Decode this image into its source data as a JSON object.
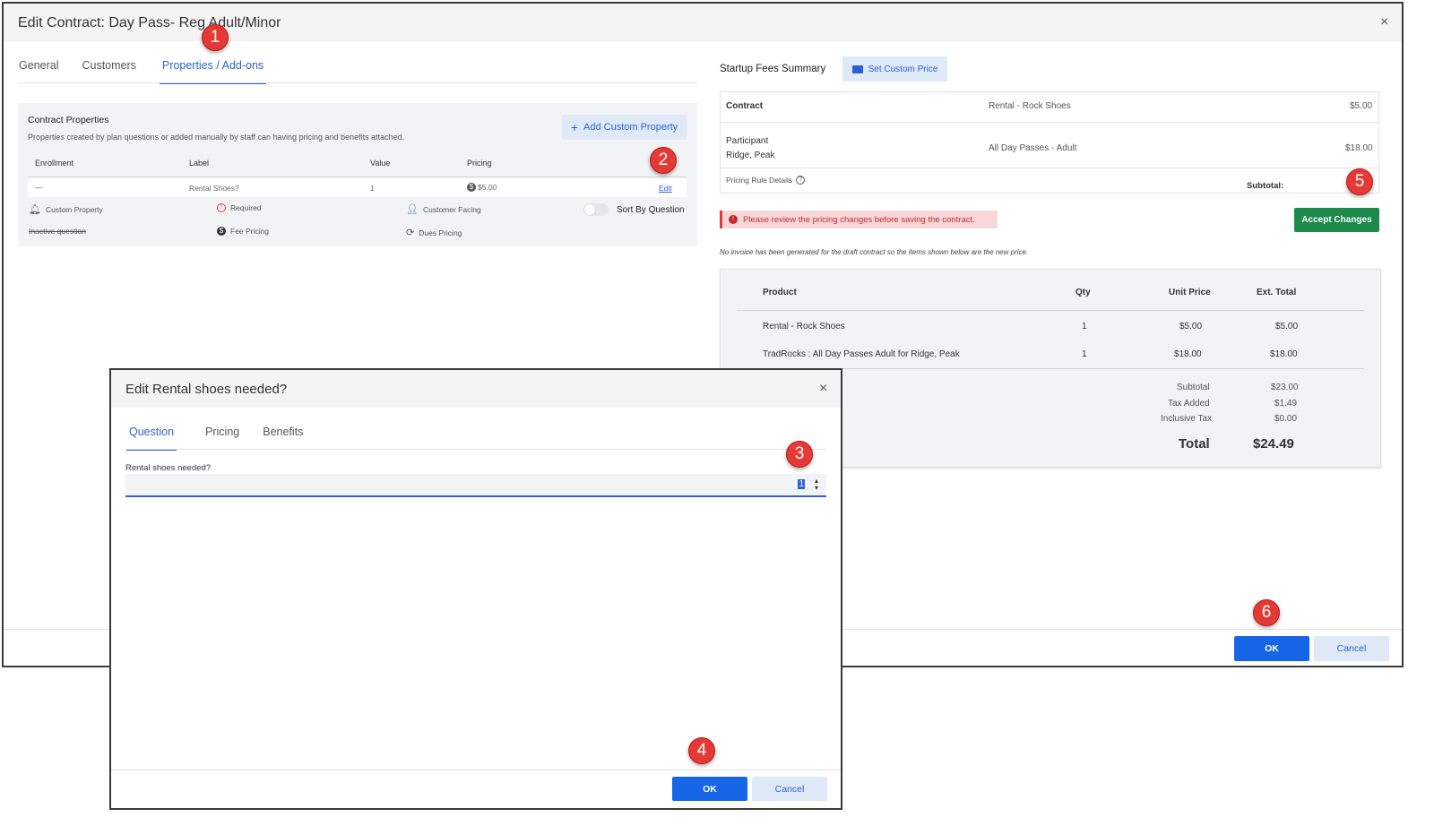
{
  "outer": {
    "title": "Edit Contract: Day Pass- Reg Adult/Minor",
    "close": "×",
    "tabs": [
      "General",
      "Customers",
      "Properties / Add-ons"
    ],
    "ok": "OK",
    "cancel": "Cancel"
  },
  "properties": {
    "heading": "Contract Properties",
    "description": "Properties created by plan questions or added manually by staff can having pricing and benefits attached.",
    "add_button": "Add Custom Property",
    "columns": [
      "Enrollment",
      "Label",
      "Value",
      "Pricing"
    ],
    "row": {
      "enrollment": "—",
      "label": "Rental Shoes?",
      "value": "1",
      "pricing": "$5.00",
      "action": "Edit"
    },
    "legend": {
      "custom_property": "Custom Property",
      "required": "Required",
      "customer_facing": "Customer Facing",
      "inactive_question": "Inactive question",
      "fee_pricing": "Fee Pricing",
      "dues_pricing": "Dues Pricing"
    },
    "sort_label": "Sort By Question"
  },
  "summary": {
    "heading": "Startup Fees Summary",
    "custom_price_button": "Set Custom Price",
    "contract_label": "Contract",
    "contract_item": "Rental - Rock Shoes",
    "contract_amount": "$5.00",
    "participant_label": "Participant",
    "participant_name": "Ridge, Peak",
    "participant_item": "All Day Passes - Adult",
    "participant_amount": "$18.00",
    "pricing_rule": "Pricing Rule Details",
    "subtotal_label": "Subtotal:",
    "warning": "Please review the pricing changes before saving the contract.",
    "accept_button": "Accept Changes",
    "note": "No invoice has been generated for the draft contract so the items shown below are the new price."
  },
  "invoice": {
    "columns": [
      "Product",
      "Qty",
      "Unit Price",
      "Ext. Total"
    ],
    "rows": [
      {
        "product": "Rental - Rock Shoes",
        "qty": "1",
        "unit": "$5.00",
        "ext": "$5.00"
      },
      {
        "product": "TradRocks : All Day Passes Adult for Ridge, Peak",
        "qty": "1",
        "unit": "$18.00",
        "ext": "$18.00"
      }
    ],
    "subtotal_label": "Subtotal",
    "subtotal": "$23.00",
    "tax_label": "Tax Added",
    "tax": "$1.49",
    "inclusive_label": "Inclusive Tax",
    "inclusive": "$0.00",
    "total_label": "Total",
    "total": "$24.49"
  },
  "inner": {
    "title": "Edit Rental shoes needed?",
    "close": "×",
    "tabs": [
      "Question",
      "Pricing",
      "Benefits"
    ],
    "field_label": "Rental shoes needed?",
    "field_value": "1",
    "ok": "OK",
    "cancel": "Cancel"
  },
  "badges": [
    "1",
    "2",
    "3",
    "4",
    "5",
    "6"
  ],
  "colors": {
    "accent": "#2a62d4",
    "primary": "#1565e6",
    "success": "#1b8a4b",
    "danger": "#e53935"
  }
}
